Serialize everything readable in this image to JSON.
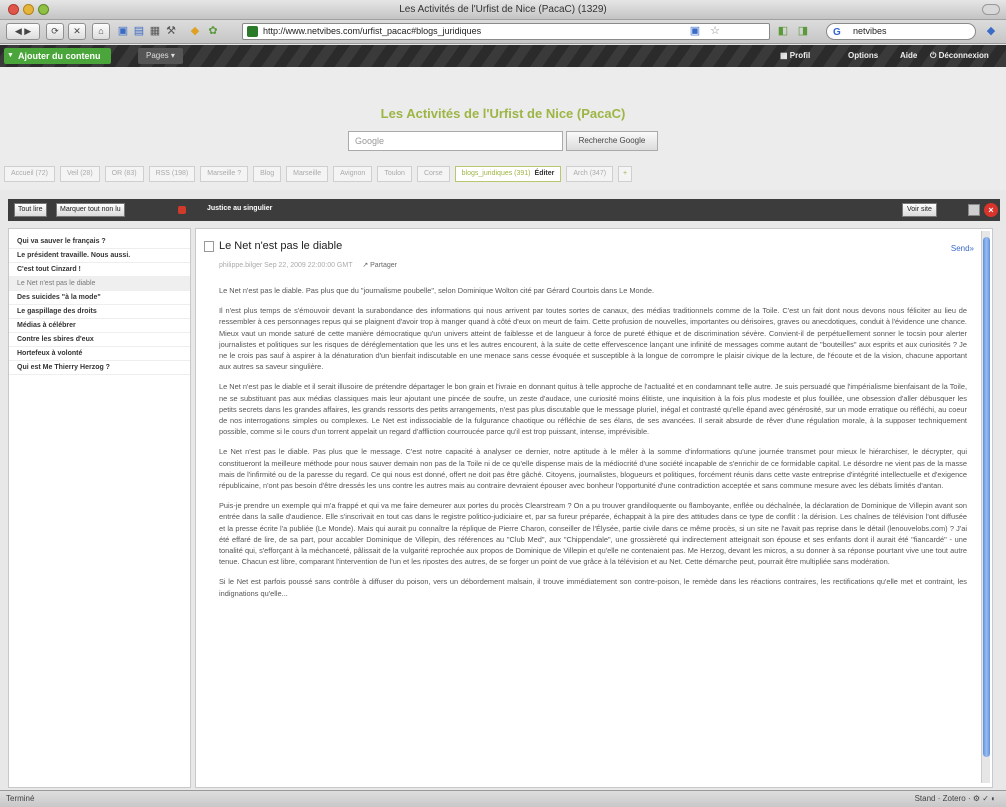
{
  "window": {
    "title": "Les Activités de l'Urfist de Nice (PacaC) (1329)"
  },
  "browser": {
    "url": "http://www.netvibes.com/urfist_pacac#blogs_juridiques",
    "search_value": "netvibes",
    "search_engine_icon": "G"
  },
  "netvibes_bar": {
    "add_content": "Ajouter du contenu",
    "pages": "Pages ▾",
    "profile": "Profil",
    "options": "Options",
    "help": "Aide",
    "logout": "Déconnexion"
  },
  "header": {
    "title": "Les Activités de l'Urfist de Nice (PacaC)",
    "search_placeholder": "Google",
    "search_button": "Recherche Google"
  },
  "tabs": [
    {
      "label": "Accueil (72)"
    },
    {
      "label": "Veil (28)"
    },
    {
      "label": "OR (83)"
    },
    {
      "label": "RSS (198)"
    },
    {
      "label": "Marseille ?"
    },
    {
      "label": "Blog"
    },
    {
      "label": "Marseille"
    },
    {
      "label": "Avignon"
    },
    {
      "label": "Toulon"
    },
    {
      "label": "Corse"
    },
    {
      "label": "blogs_juridiques (391)",
      "edit": "Éditer",
      "active": true
    },
    {
      "label": "Arch (347)"
    }
  ],
  "panel": {
    "read_all": "Tout lire",
    "mark_all": "Marquer tout non lu",
    "feed_name": "Justice au singulier",
    "view_site": "Voir site"
  },
  "sidebar": {
    "items": [
      {
        "label": "Qui va sauver le français ?",
        "bold": true
      },
      {
        "label": "Le président travaille. Nous aussi.",
        "bold": true
      },
      {
        "label": "C'est tout Cinzard !",
        "bold": true
      },
      {
        "label": "Le Net n'est pas le diable",
        "bold": false,
        "selected": true
      },
      {
        "label": "Des suicides \"à la mode\"",
        "bold": true
      },
      {
        "label": "Le gaspillage des droits",
        "bold": true
      },
      {
        "label": "Médias à célébrer",
        "bold": true
      },
      {
        "label": "Contre les sbires d'eux",
        "bold": true
      },
      {
        "label": "Hortefeux à volonté",
        "bold": true
      },
      {
        "label": "Qui est Me Thierry Herzog ?",
        "bold": true
      }
    ]
  },
  "article": {
    "title": "Le Net n'est pas le diable",
    "meta": "philippe.bilger Sep 22, 2009 22:00:00 GMT",
    "share": "↗ Partager",
    "send": "Send»",
    "paragraphs": [
      "Le Net n'est pas le diable. Pas plus que du \"journalisme poubelle\", selon Dominique Wolton cité par Gérard Courtois dans Le Monde.",
      "Il n'est plus temps de s'émouvoir devant la surabondance des informations qui nous arrivent par toutes sortes de canaux, des médias traditionnels comme de la Toile. C'est un fait dont nous devons nous féliciter au lieu de ressembler à ces personnages repus qui se plaignent d'avoir trop à manger quand à côté d'eux on meurt de faim. Cette profusion de nouvelles, importantes ou dérisoires, graves ou anecdotiques, conduit à l'évidence une chance. Mieux vaut un monde saturé de cette manière démocratique qu'un univers atteint de faiblesse et de langueur à force de pureté éthique et de discrimination sévère. Convient-il de perpétuellement sonner le tocsin pour alerter journalistes et politiques sur les risques de déréglementation que les uns et les autres encourent, à la suite de cette effervescence lançant une infinité de messages comme autant de \"bouteilles\" aux esprits et aux curiosités ? Je ne le crois pas sauf à aspirer à la dénaturation d'un bienfait indiscutable en une menace sans cesse évoquée et susceptible à la longue de corrompre le plaisir civique de la lecture, de l'écoute et de la vision, chacune apportant aux autres sa saveur singulière.",
      "Le Net n'est pas le diable et il serait illusoire de prétendre départager le bon grain et l'ivraie en donnant quitus à telle approche de l'actualité et en condamnant telle autre. Je suis persuadé que l'impérialisme bienfaisant de la Toile, ne se substituant pas aux médias classiques mais leur ajoutant une pincée de soufre, un zeste d'audace, une curiosité moins élitiste, une inquisition à la fois plus modeste et plus fouillée, une obsession d'aller débusquer les petits secrets dans les grandes affaires, les grands ressorts des petits arrangements, n'est pas plus discutable que le message pluriel, inégal et contrasté qu'elle épand avec générosité, sur un mode erratique ou réfléchi, au coeur de nos interrogations simples ou complexes. Le Net est indissociable de la fulgurance chaotique ou réfléchie de ses élans, de ses avancées. Il serait absurde de rêver d'une régulation morale, à la supposer techniquement possible, comme si le cours d'un torrent appelait un regard d'affliction courroucée parce qu'il est trop puissant, intense, imprévisible.",
      "Le Net n'est pas le diable. Pas plus que le message. C'est notre capacité à analyser ce dernier, notre aptitude à le mêler à la somme d'informations qu'une journée transmet pour mieux le hiérarchiser, le décrypter, qui constitueront la meilleure méthode pour nous sauver demain non pas de la Toile ni de ce qu'elle dispense mais de la médiocrité d'une société incapable de s'enrichir de ce formidable capital. Le désordre ne vient pas de la masse mais de l'infirmité ou de la paresse du regard. Ce qui nous est donné, offert ne doit pas être gâché. Citoyens, journalistes, blogueurs et politiques, forcément réunis dans cette vaste entreprise d'intégrité intellectuelle et d'exigence républicaine, n'ont pas besoin d'être dressés les uns contre les autres mais au contraire devraient épouser avec bonheur l'opportunité d'une contradiction acceptée et sans commune mesure avec les débats limités d'antan.",
      "Puis-je prendre un exemple qui m'a frappé et qui va me faire demeurer aux portes du procès Clearstream ? On a pu trouver grandiloquente ou flamboyante, enflée ou déchaînée, la déclaration de Dominique de Villepin avant son entrée dans la salle d'audience. Elle s'inscrivait en tout cas dans le registre politico-judiciaire et, par sa fureur préparée, échappait à la pire des attitudes dans ce type de conflit : la dérision. Les chaînes de télévision l'ont diffusée et la presse écrite l'a publiée (Le Monde). Mais qui aurait pu connaître la réplique de Pierre Charon, conseiller de l'Élysée, partie civile dans ce même procès, si un site ne l'avait pas reprise dans le détail (lenouvelobs.com) ? J'ai été effaré de lire, de sa part, pour accabler Dominique de Villepin, des références au \"Club Med\", aux \"Chippendale\", une grossièreté qui indirectement atteignait son épouse et ses enfants dont il aurait été \"fiancardé\" - une tonalité qui, s'efforçant à la méchanceté, pâlissait de la vulgarité reprochée aux propos de Dominique de Villepin et qu'elle ne contenaient pas. Me Herzog, devant les micros, a su donner à sa réponse pourtant vive une tout autre tenue. Chacun est libre, comparant l'intervention de l'un et les ripostes des autres, de se forger un point de vue grâce à la télévision et au Net. Cette démarche peut, pourrait être multipliée sans modération.",
      "Si le Net est parfois poussé sans contrôle à diffuser du poison, vers un débordement malsain, il trouve immédiatement son contre-poison, le remède dans les réactions contraires, les rectifications qu'elle met et contraint, les indignations qu'elle..."
    ]
  },
  "status": {
    "left": "Terminé",
    "right": "Stand · Zotero · ⚙ ✓ ◐"
  }
}
